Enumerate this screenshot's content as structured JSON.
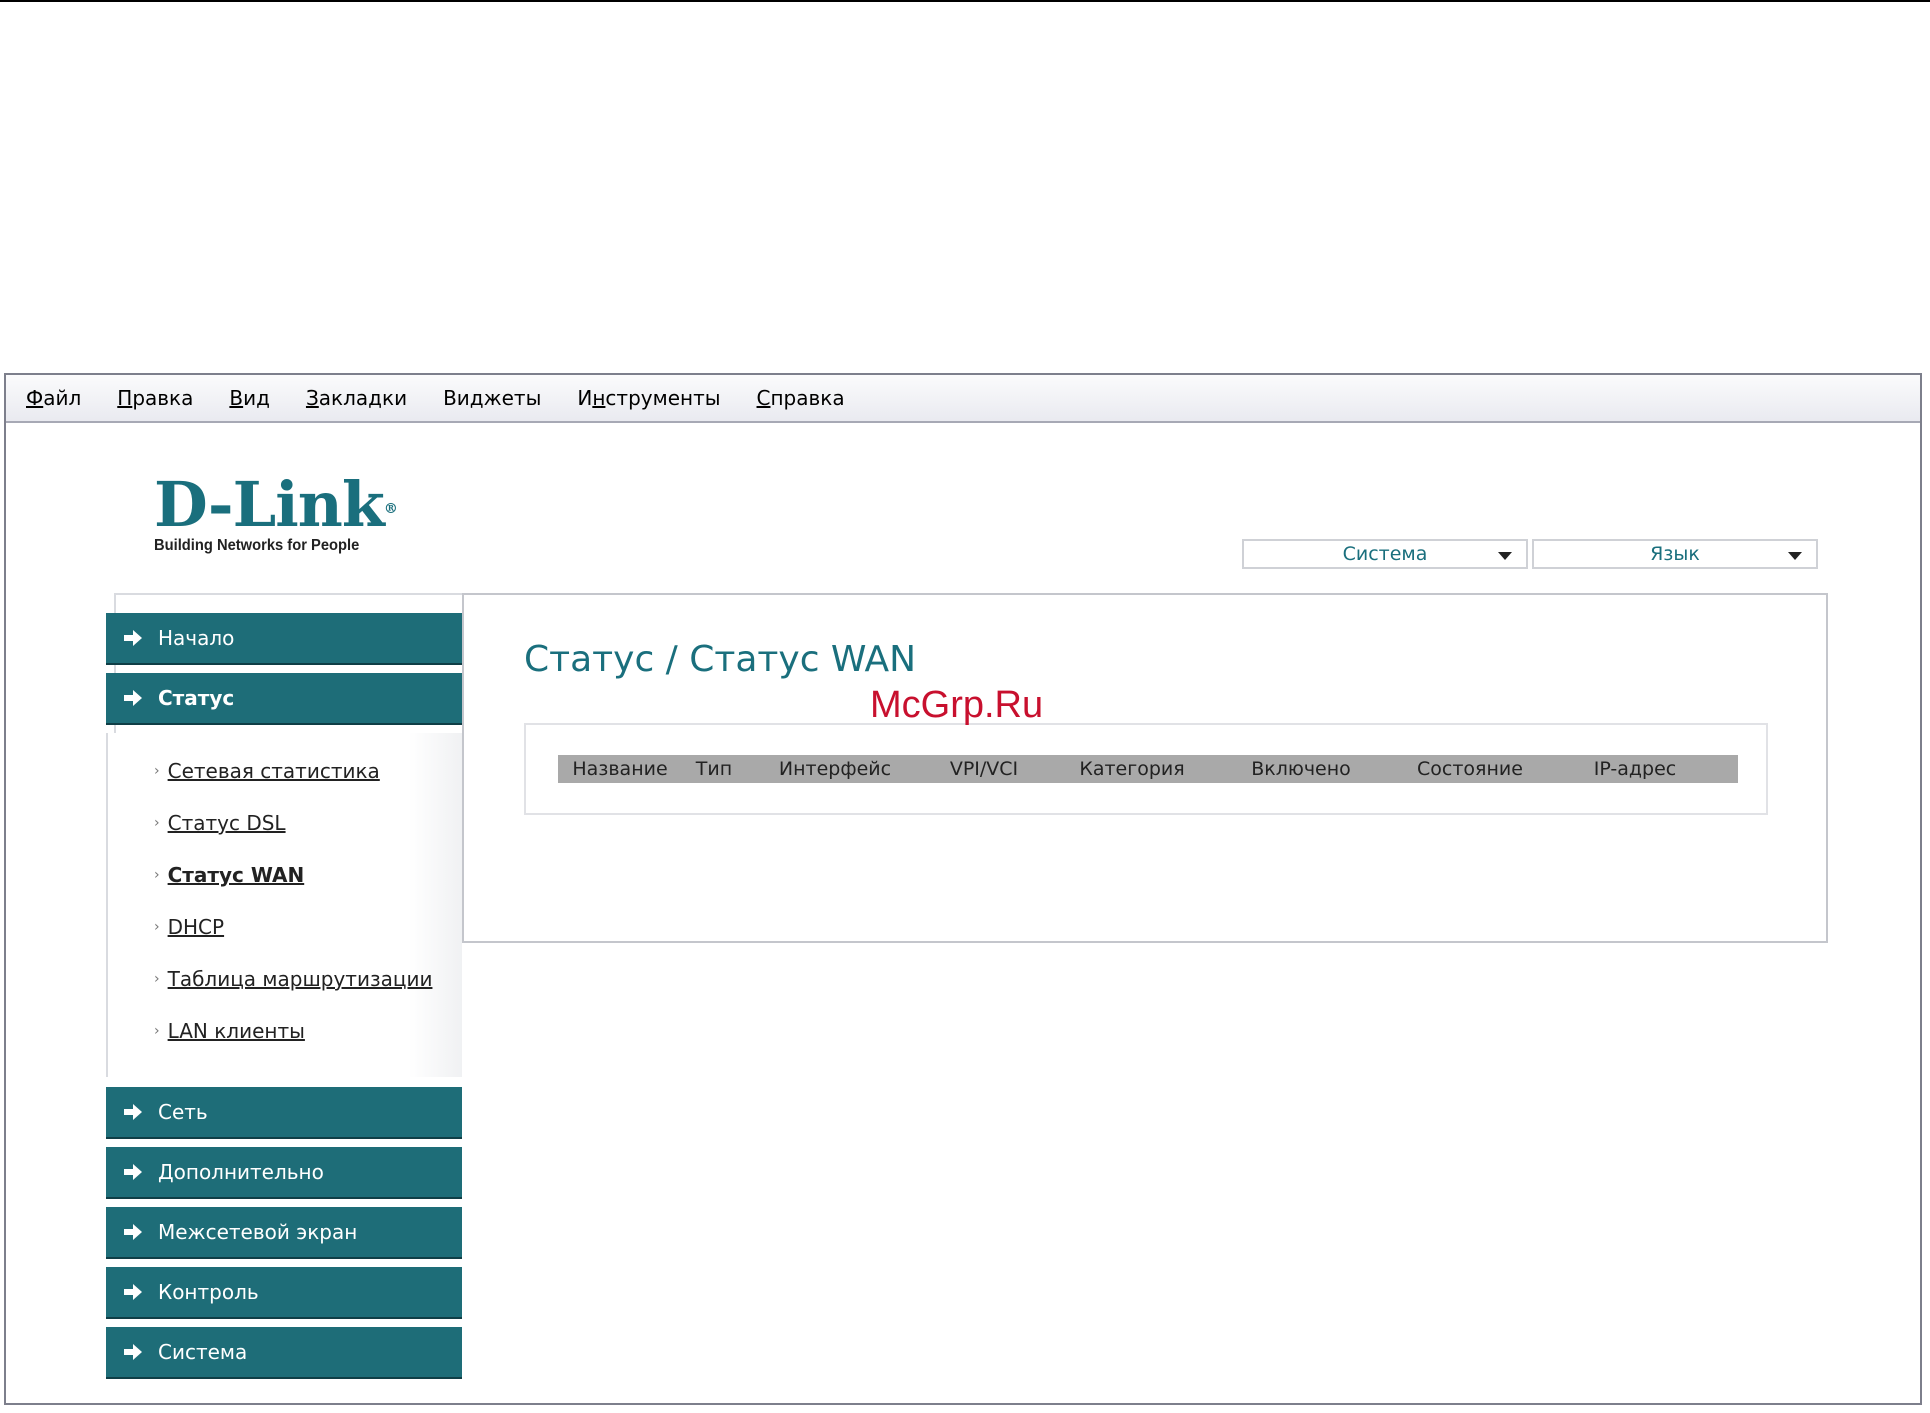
{
  "menubar": {
    "items": [
      {
        "pre": "",
        "u": "Ф",
        "post": "айл"
      },
      {
        "pre": "",
        "u": "П",
        "post": "равка"
      },
      {
        "pre": "",
        "u": "В",
        "post": "ид"
      },
      {
        "pre": "",
        "u": "З",
        "post": "акладки"
      },
      {
        "pre": "Ви",
        "u": "д",
        "post": "жеты"
      },
      {
        "pre": "И",
        "u": "н",
        "post": "струменты"
      },
      {
        "pre": "",
        "u": "С",
        "post": "правка"
      }
    ]
  },
  "logo": {
    "brand": "D-Link",
    "reg": "®",
    "tagline": "Building Networks for People"
  },
  "dropdowns": {
    "system": "Система",
    "language": "Язык"
  },
  "sidebar": {
    "top": [
      {
        "label": "Начало"
      },
      {
        "label": "Статус"
      }
    ],
    "sub": [
      {
        "label": "Сетевая статистика"
      },
      {
        "label": "Статус DSL"
      },
      {
        "label": "Статус WAN"
      },
      {
        "label": "DHCP"
      },
      {
        "label": "Таблица маршрутизации"
      },
      {
        "label": "LAN клиенты"
      }
    ],
    "bottom": [
      {
        "label": "Сеть"
      },
      {
        "label": "Дополнительно"
      },
      {
        "label": "Межсетевой экран"
      },
      {
        "label": "Контроль"
      },
      {
        "label": "Система"
      }
    ],
    "bullet": "›"
  },
  "main": {
    "title": "Статус / Статус WAN",
    "table": {
      "headers": [
        "Название",
        "Тип",
        "Интерфейс",
        "VPI/VCI",
        "Категория",
        "Включено",
        "Состояние",
        "IP-адрес"
      ]
    }
  },
  "watermark": "McGrp.Ru",
  "colors": {
    "accent": "#1e6d78",
    "title": "#1a6f7d",
    "header_bg": "#a9a9a9",
    "watermark": "#c8102e"
  }
}
